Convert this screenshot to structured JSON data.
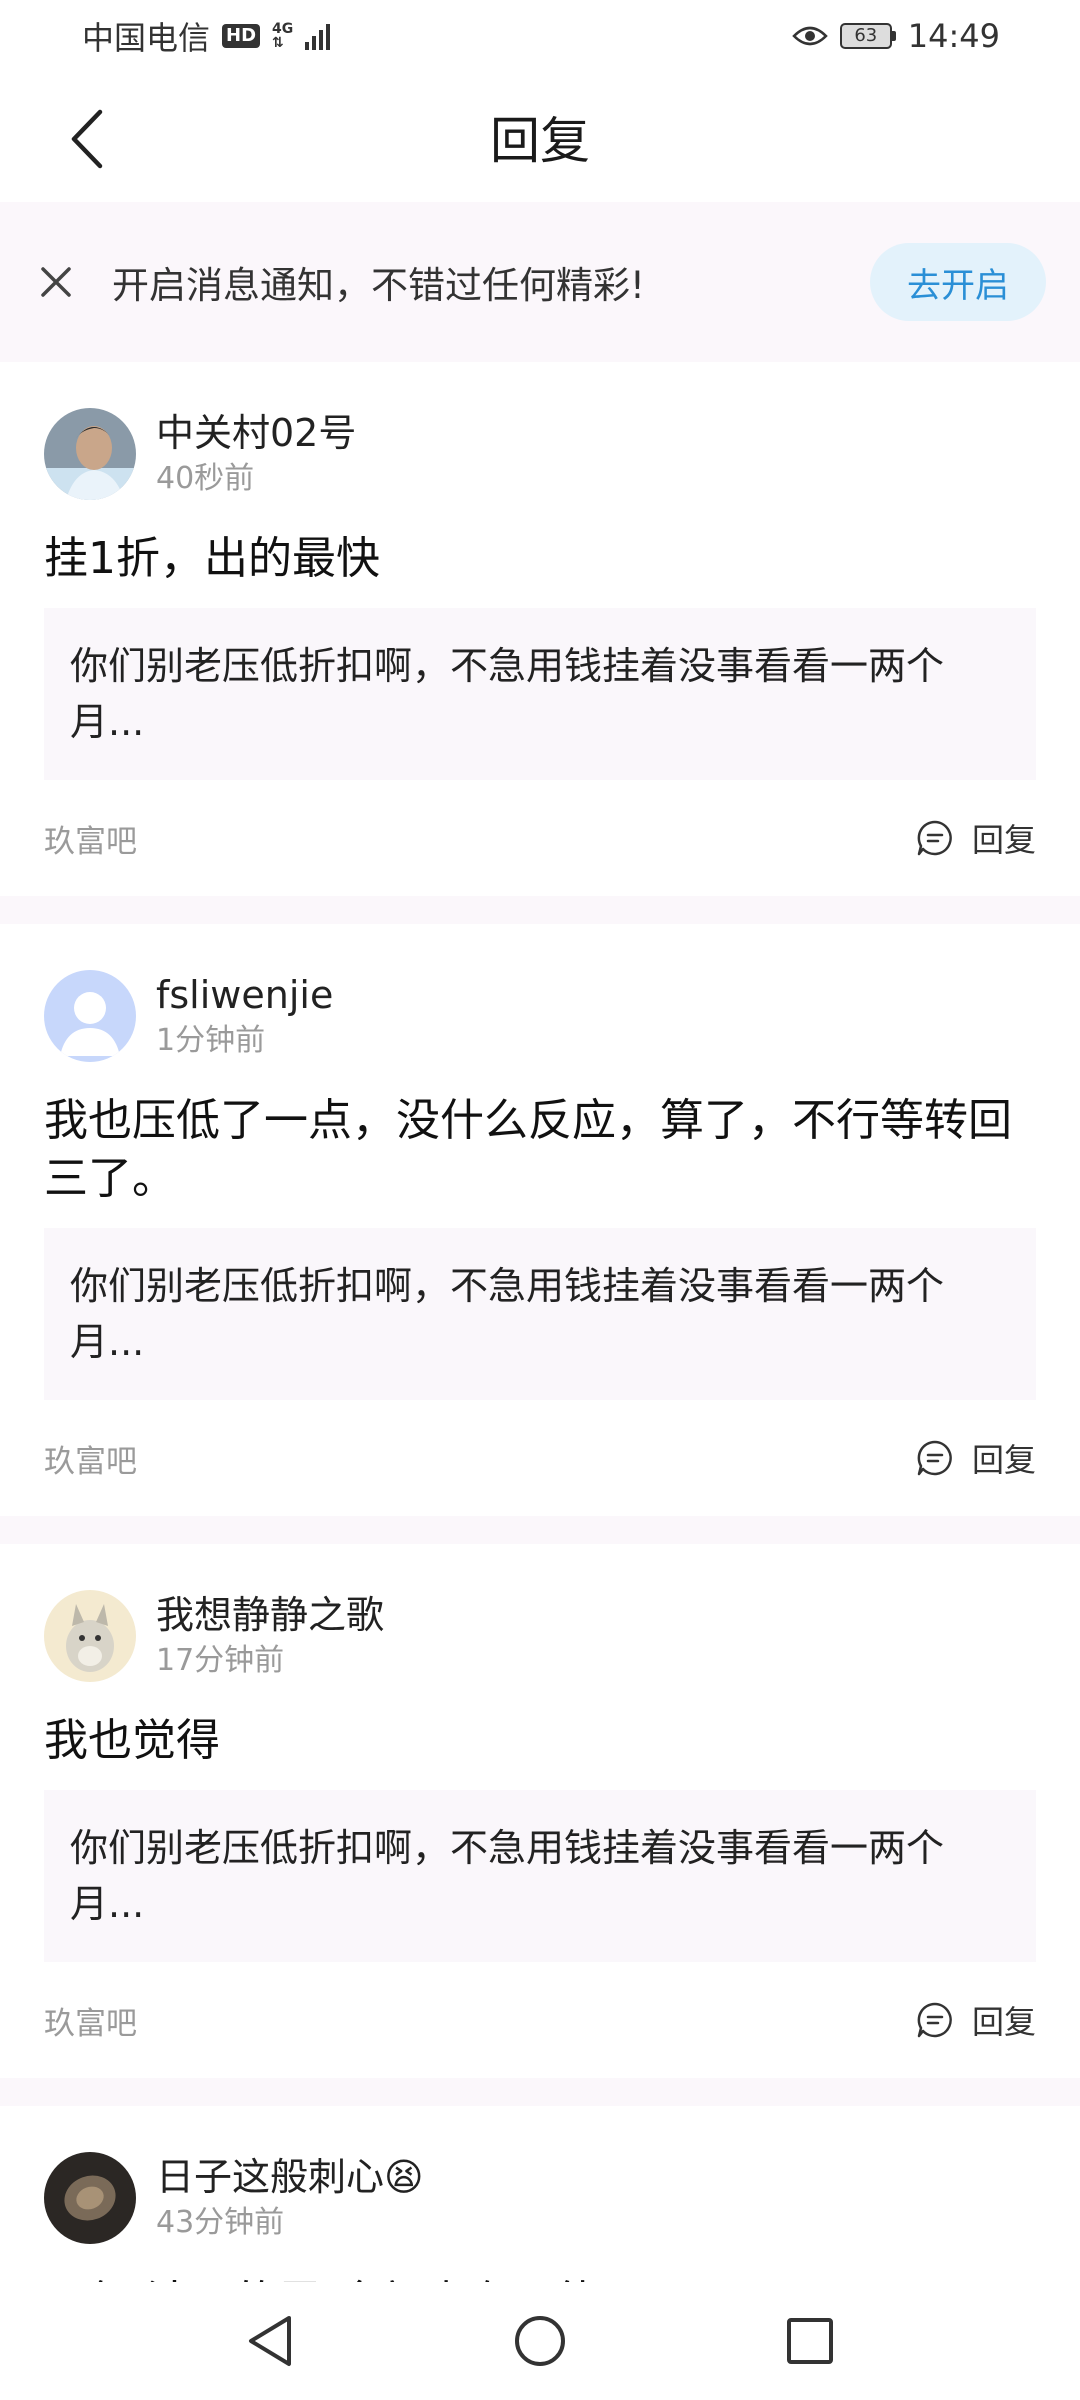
{
  "status": {
    "carrier": "中国电信",
    "hd": "HD",
    "network": "4G",
    "battery": "63",
    "time": "14:49"
  },
  "header": {
    "title": "回复"
  },
  "notice": {
    "text": "开启消息通知，不错过任何精彩!",
    "button": "去开启"
  },
  "replies": [
    {
      "user": "中关村02号",
      "time": "40秒前",
      "text": "挂1折，出的最快",
      "quote": "你们别老压低折扣啊，不急用钱挂着没事看看一两个月...",
      "forum": "玖富吧",
      "action": "回复"
    },
    {
      "user": "fsliwenjie",
      "time": "1分钟前",
      "text": "我也压低了一点，没什么反应，算了，不行等转回三了。",
      "quote": "你们别老压低折扣啊，不急用钱挂着没事看看一两个月...",
      "forum": "玖富吧",
      "action": "回复"
    },
    {
      "user": "我想静静之歌",
      "time": "17分钟前",
      "text": "我也觉得",
      "quote": "你们别老压低折扣啊，不急用钱挂着没事看看一两个月...",
      "forum": "玖富吧",
      "action": "回复"
    },
    {
      "user": "日子这般刺心😫",
      "time": "43分钟前",
      "text": "回复 涉月的雷:金额少有可能"
    }
  ],
  "colors": {
    "accent": "#2a8fd6",
    "banner_bg": "#fbf7fb",
    "muted": "#9a9a9a"
  }
}
